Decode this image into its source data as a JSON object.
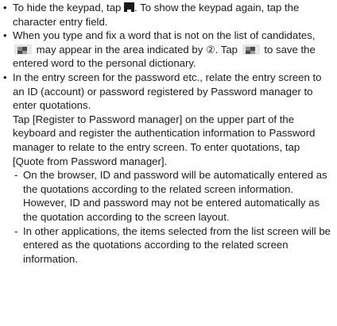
{
  "bullets": [
    {
      "text_a": "To hide the keypad, tap ",
      "icon_name": "hide-keypad-icon",
      "text_b": ". To show the keypad again, tap the character entry field."
    },
    {
      "text_a": "When you type and fix a word that is not on the list of candidates, ",
      "icon_name": "save-word-icon",
      "text_b": " may appear in the area indicated by ",
      "circled": "②",
      "text_c": ". Tap ",
      "text_d": " to save the entered word to the personal dictionary."
    },
    {
      "text_a": "In the entry screen for the password etc., relate the entry screen to an ID (account) or password registered by Password manager to enter quotations.",
      "text_b": "Tap [Register to Password manager] on the upper part of the keyboard and register the authentication information to Password manager to relate to the entry screen. To enter quotations, tap [Quote from Password manager].",
      "sub_items": [
        "On the browser, ID and password will be automatically entered as the quotations according to the related screen information. However, ID and password may not be entered automatically as the quotation according to the screen layout.",
        "In other applications, the items selected from the list screen will be entered as the quotations according to the related screen information."
      ]
    }
  ]
}
